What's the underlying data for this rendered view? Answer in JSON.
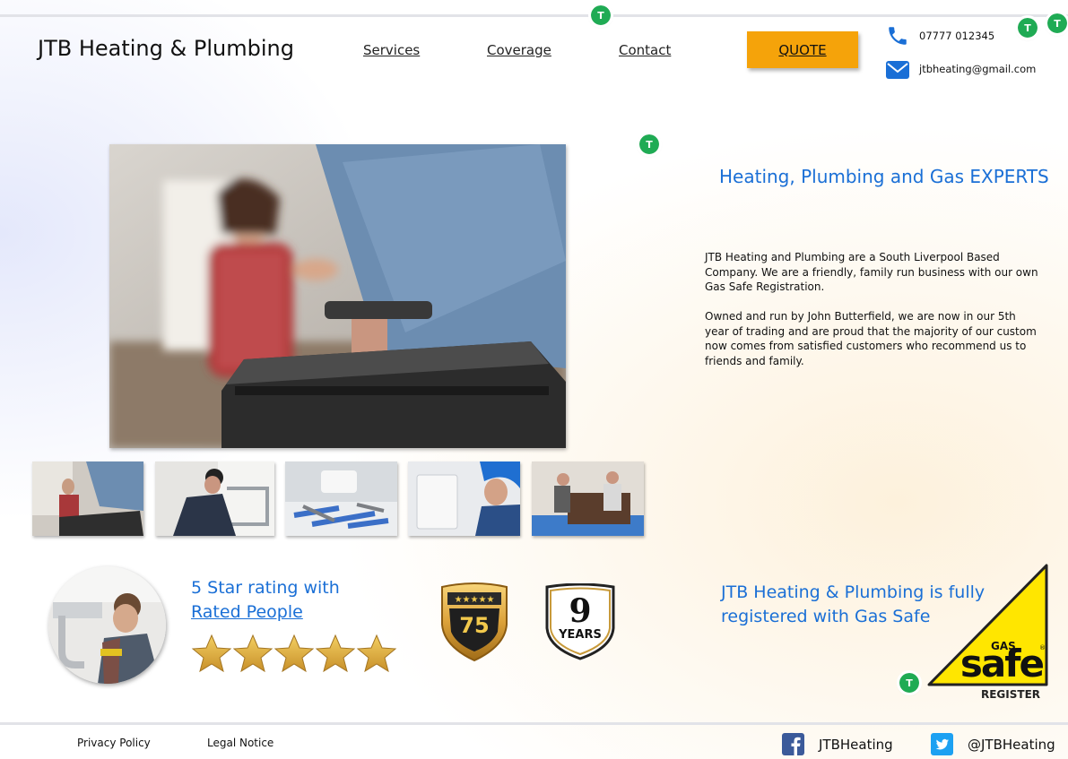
{
  "header": {
    "brand": "JTB Heating & Plumbing",
    "nav": [
      "Services",
      "Coverage",
      "Contact"
    ],
    "quote_label": "QUOTE",
    "phone": "07777 012345",
    "email": "jtbheating@gmail.com",
    "phone_icon": "phone-icon",
    "email_icon": "envelope-icon"
  },
  "badge_letter": "T",
  "main": {
    "headline": "Heating, Plumbing and Gas EXPERTS",
    "paragraph1": "JTB Heating and Plumbing are a South Liverpool Based Company. We are a friendly, family run business with our own Gas Safe Registration.",
    "paragraph2": "Owned and run by John Butterfield, we are now in our 5th year of trading and are proud that the majority of our custom now comes from satisfied customers who recommend us to friends and family."
  },
  "gallery": {
    "count": 5
  },
  "rating": {
    "line1": "5 Star rating with",
    "link": "Rated People",
    "stars": 5
  },
  "badges": {
    "count_badge": "75",
    "years_number": "9",
    "years_label": "YEARS"
  },
  "gas_safe": {
    "text": "JTB Heating & Plumbing is fully registered with Gas Safe",
    "logo_top": "GAS",
    "logo_main": "safe",
    "logo_bottom": "REGISTER"
  },
  "footer": {
    "privacy": "Privacy Policy",
    "legal": "Legal Notice",
    "facebook": "JTBHeating",
    "twitter": "@JTBHeating"
  },
  "colors": {
    "accent_blue": "#1a6fd6",
    "quote_orange": "#f5a30a",
    "badge_green": "#1fab54",
    "gas_safe_yellow": "#ffe600"
  }
}
